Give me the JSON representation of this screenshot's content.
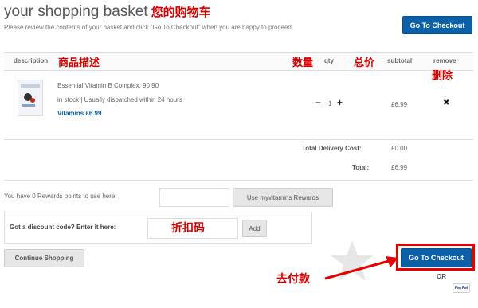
{
  "header": {
    "title": "your shopping basket",
    "title_cn": "您的购物车",
    "subtitle": "Please review the contents of your basket and click \"Go To Checkout\" when you are happy to proceed.",
    "checkout_label": "Go To Checkout"
  },
  "columns": {
    "description": "description",
    "description_cn": "商品描述",
    "qty": "qty",
    "qty_cn": "数量",
    "subtotal": "subtotal",
    "subtotal_cn": "总价",
    "remove": "remove",
    "remove_cn": "删除"
  },
  "item": {
    "name": "Essential Vitamin B Complex, 90 90",
    "stock": "in stock | Usually dispatched within 24 hours",
    "price_link": "Vitamins £6.99",
    "qty_minus": "−",
    "qty": "1",
    "qty_plus": "+",
    "subtotal": "£6.99",
    "remove_icon": "✖"
  },
  "totals": {
    "delivery_label": "Total Delivery Cost:",
    "delivery_value": "£0.00",
    "total_label": "Total:",
    "total_value": "£6.99"
  },
  "rewards": {
    "text": "You have 0 Rewards points to use here:",
    "button": "Use myvitamins Rewards"
  },
  "discount": {
    "label": "Got a discount code? Enter it here:",
    "label_cn": "折扣码",
    "button": "Add"
  },
  "footer": {
    "continue": "Continue Shopping",
    "checkout": "Go To Checkout",
    "checkout_cn": "去付款",
    "or": "OR",
    "paypal": "PayPal"
  },
  "colors": {
    "accent": "#0b61a8",
    "annotation": "#e60000"
  }
}
